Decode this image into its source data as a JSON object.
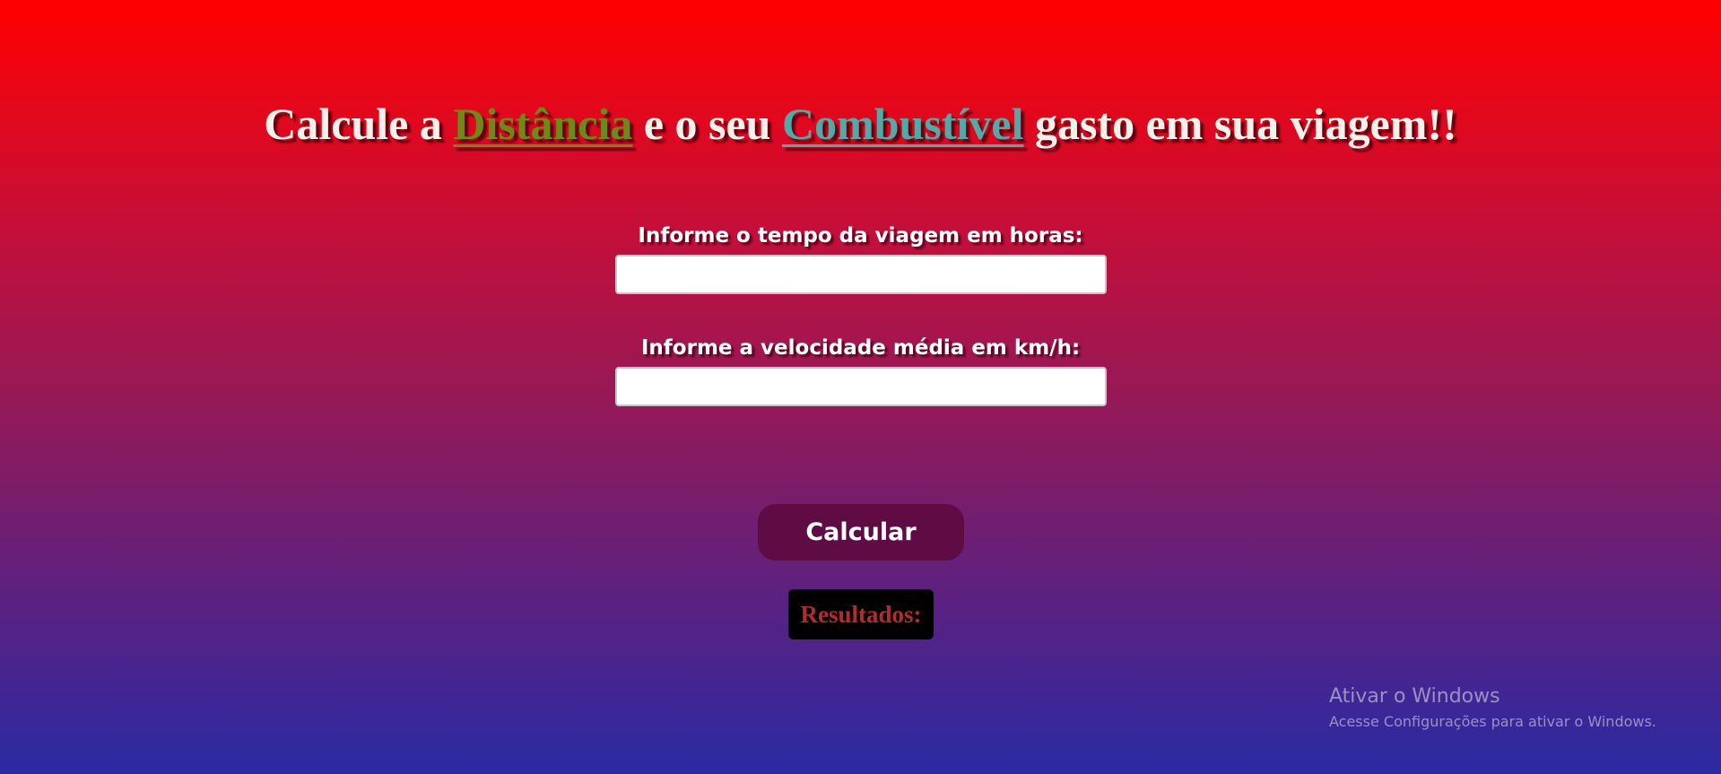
{
  "header": {
    "title_prefix": "Calcule a ",
    "title_keyword_1": "Distância",
    "title_middle": " e o seu ",
    "title_keyword_2": "Combustível",
    "title_suffix": " gasto em sua viagem!!"
  },
  "form": {
    "tempo_label": "Informe o tempo da viagem em horas:",
    "tempo_value": "",
    "velocidade_label": "Informe a velocidade média em km/h:",
    "velocidade_value": "",
    "submit_label": "Calcular"
  },
  "results": {
    "label": "Resultados:"
  },
  "windows_watermark": {
    "title": "Ativar o Windows",
    "subtitle": "Acesse Configurações para ativar o Windows."
  }
}
